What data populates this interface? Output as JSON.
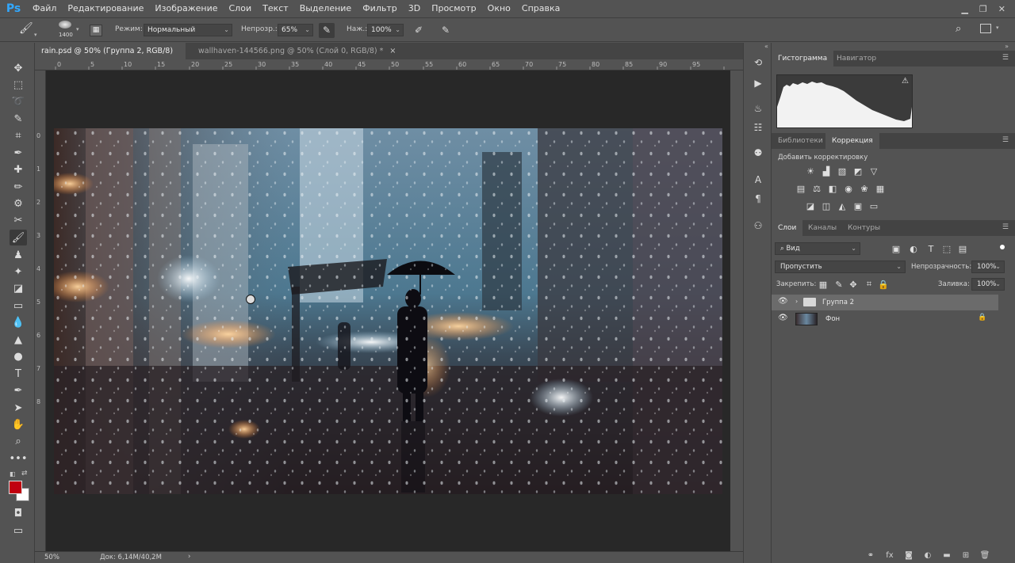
{
  "app": {
    "logo": "Ps"
  },
  "menu": [
    "Файл",
    "Редактирование",
    "Изображение",
    "Слои",
    "Текст",
    "Выделение",
    "Фильтр",
    "3D",
    "Просмотр",
    "Окно",
    "Справка"
  ],
  "options": {
    "brush_size": "1400",
    "mode_label": "Режим:",
    "mode_value": "Нормальный",
    "opacity_label": "Непрозр.:",
    "opacity_value": "65%",
    "pressure_label": "Наж.:",
    "pressure_value": "100%"
  },
  "doc_tabs": [
    {
      "label": "rain.psd @ 50% (Группа 2, RGB/8) *",
      "close": "×"
    },
    {
      "label": "wallhaven-144566.png @ 50% (Слой 0, RGB/8) *",
      "close": "×"
    }
  ],
  "ruler_ticks": [
    "0",
    "5",
    "10",
    "15",
    "20",
    "25",
    "30",
    "35",
    "40",
    "45",
    "50",
    "55",
    "60",
    "65",
    "70",
    "75",
    "80",
    "85",
    "90",
    "95"
  ],
  "ruler_v_ticks": [
    "0",
    "1",
    "2",
    "3",
    "4",
    "5",
    "6",
    "7",
    "8"
  ],
  "status": {
    "zoom": "50%",
    "doc": "Док: 6,14M/40,2M",
    "arrow": "›"
  },
  "panel_histogram": {
    "tabs": [
      "Гистограмма",
      "Навигатор"
    ],
    "warning": "⚠"
  },
  "panel_adjust": {
    "tabs": [
      "Библиотеки",
      "Коррекция"
    ],
    "heading": "Добавить корректировку"
  },
  "panel_layers": {
    "tabs": [
      "Слои",
      "Каналы",
      "Контуры"
    ],
    "kind_value": "Вид",
    "blend_value": "Пропустить",
    "opacity_label": "Непрозрачность:",
    "opacity_value": "100%",
    "lock_label": "Закрепить:",
    "fill_label": "Заливка:",
    "fill_value": "100%",
    "layers": [
      {
        "name": "Группа 2",
        "type": "group"
      },
      {
        "name": "Фон",
        "type": "background"
      }
    ]
  },
  "colors": {
    "foreground": "#c0000f",
    "background": "#ffffff",
    "accent": "#31a8ff"
  }
}
